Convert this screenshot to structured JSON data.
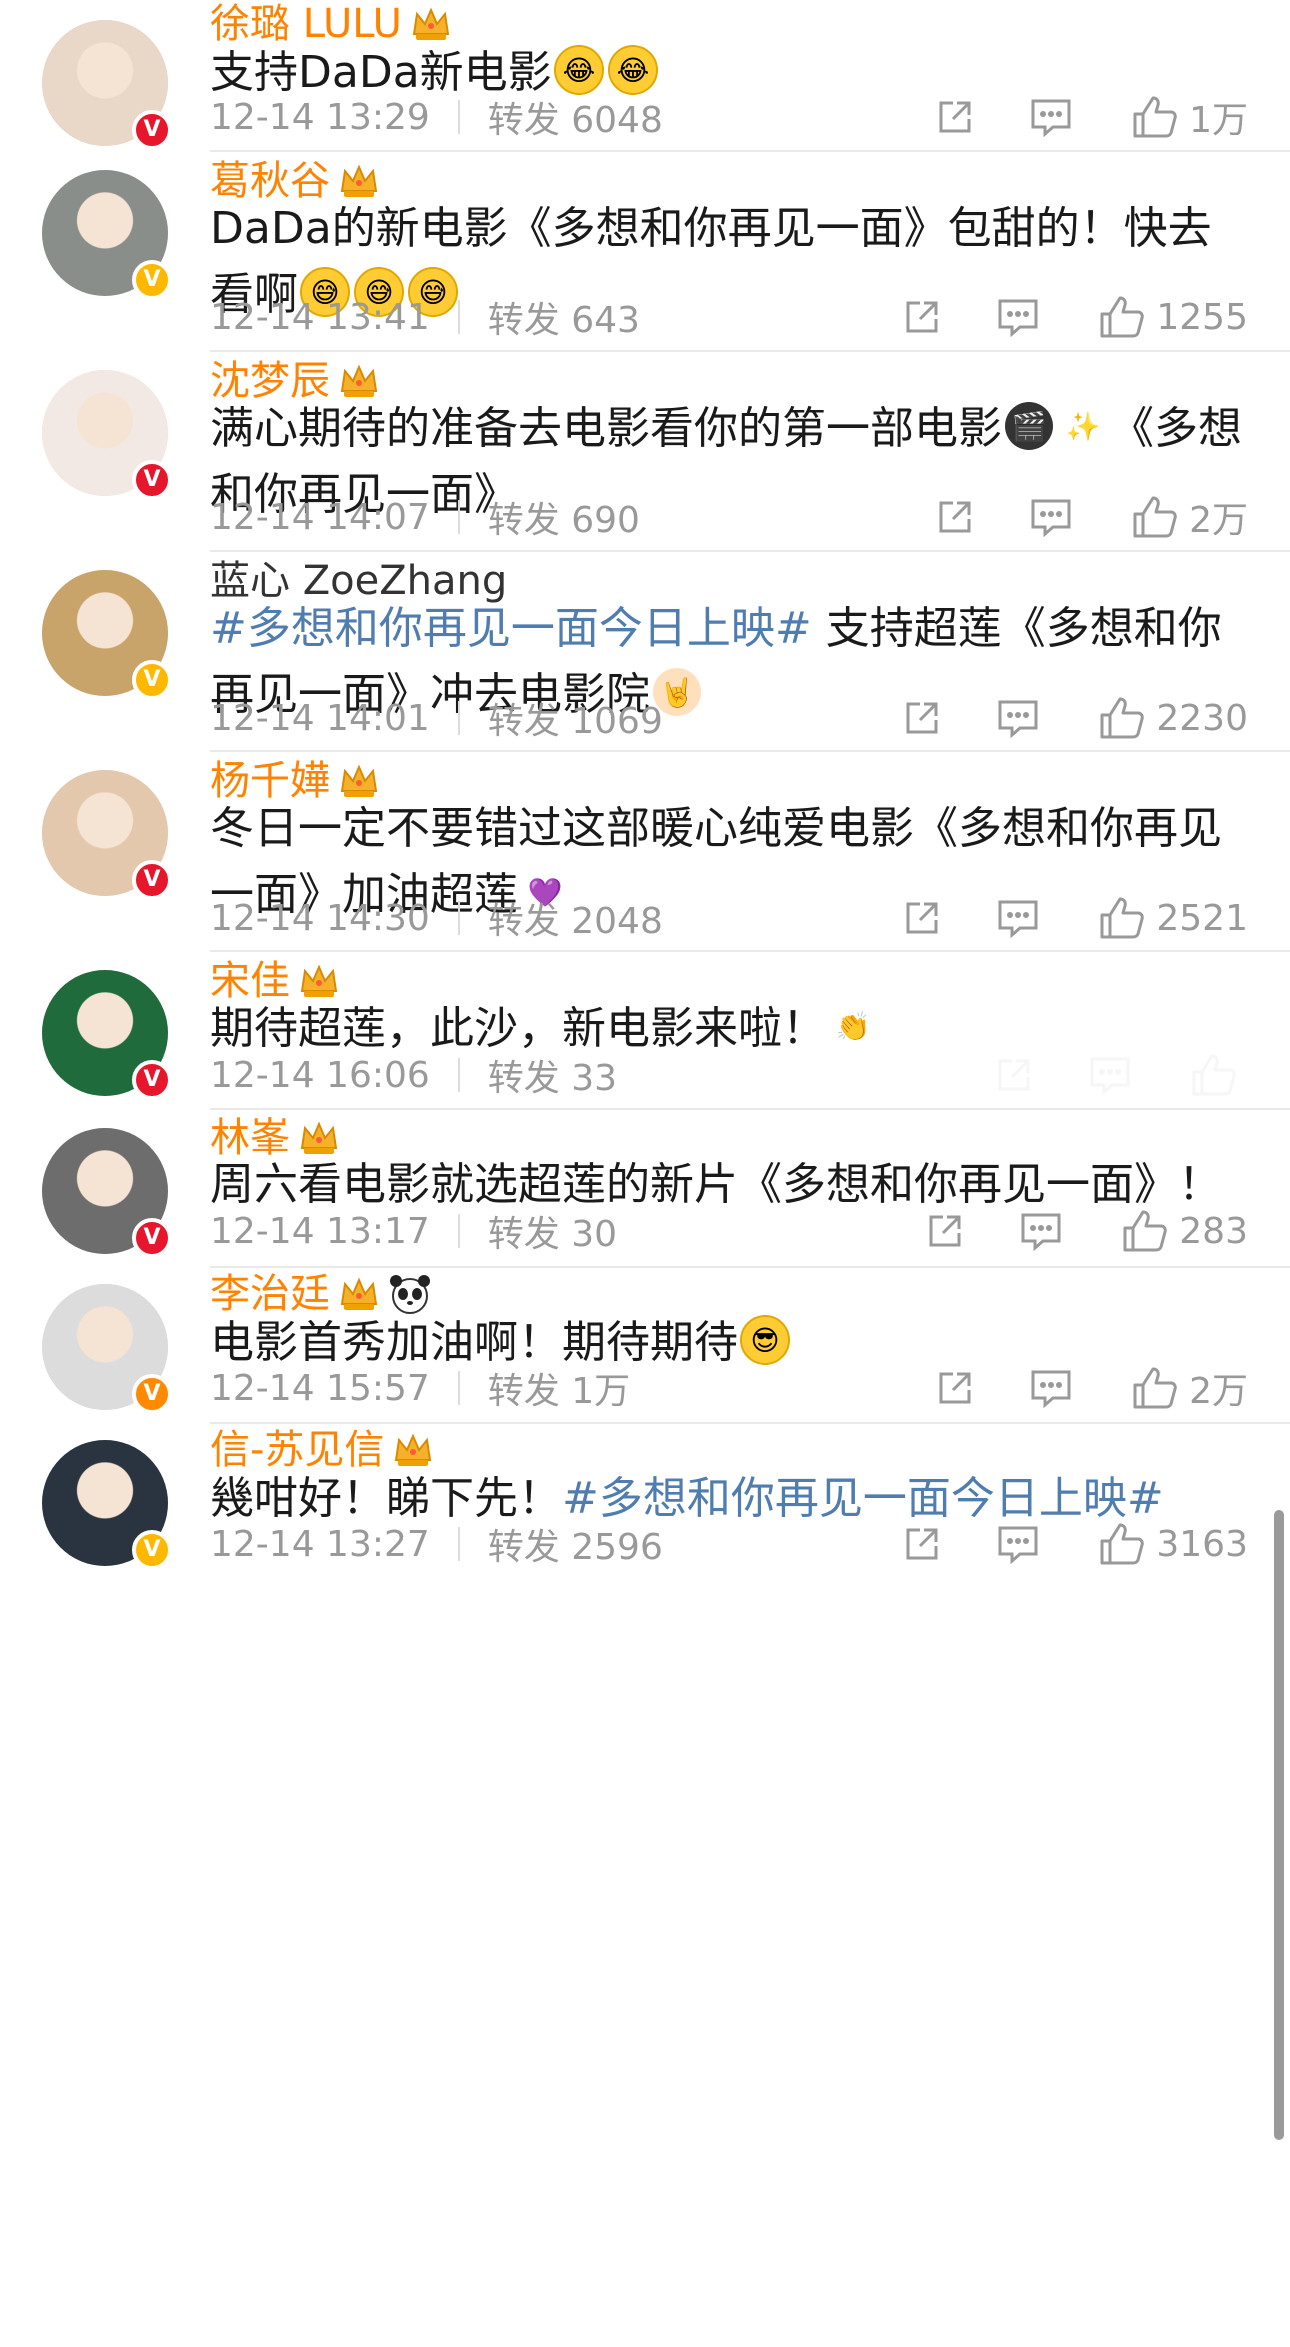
{
  "posts": [
    {
      "name": "徐璐 LULU",
      "crown": true,
      "extra_badge": null,
      "name_color": "orange",
      "badge": "red",
      "content_segments": [
        {
          "text": "支持DaDa新电影",
          "tag": false
        }
      ],
      "content_emojis": [
        "laugh-cry-emoji",
        "laugh-cry-emoji"
      ],
      "time": "12-14 13:29",
      "repost": "转发 6048",
      "likes": "1万"
    },
    {
      "name": "葛秋谷",
      "crown": true,
      "extra_badge": null,
      "name_color": "orange",
      "badge": "gold",
      "content_segments": [
        {
          "text": "DaDa的新电影《多想和你再见一面》包甜的！快去看啊",
          "tag": false
        }
      ],
      "content_emojis": [
        "sweat-laugh-emoji",
        "sweat-laugh-emoji",
        "sweat-laugh-emoji"
      ],
      "time": "12-14 13:41",
      "repost": "转发 643",
      "likes": "1255"
    },
    {
      "name": "沈梦辰",
      "crown": true,
      "extra_badge": null,
      "name_color": "orange",
      "badge": "red",
      "content_segments": [
        {
          "text": "满心期待的准备去电影看你的第一部电影",
          "tag": false
        },
        {
          "emoji": "clapperboard-emoji"
        },
        {
          "emoji": "sparkles-emoji"
        },
        {
          "text": "《多想和你再见一面》",
          "tag": false
        }
      ],
      "content_emojis": [],
      "time": "12-14 14:07",
      "repost": "转发 690",
      "likes": "2万"
    },
    {
      "name": "蓝心 ZoeZhang",
      "crown": false,
      "extra_badge": null,
      "name_color": "gray",
      "badge": "gold",
      "content_segments": [
        {
          "text": "#多想和你再见一面今日上映#",
          "tag": true
        },
        {
          "text": " 支持超莲《多想和你再见一面》冲去电影院",
          "tag": false
        }
      ],
      "content_emojis": [
        "rock-hand-emoji"
      ],
      "time": "12-14 14:01",
      "repost": "转发 1069",
      "likes": "2230"
    },
    {
      "name": "杨千嬅",
      "crown": true,
      "extra_badge": null,
      "name_color": "orange",
      "badge": "red",
      "content_segments": [
        {
          "text": "冬日一定不要错过这部暖心纯爱电影《多想和你再见一面》加油超莲",
          "tag": false
        }
      ],
      "content_emojis": [
        "purple-heart-emoji"
      ],
      "time": "12-14 14:30",
      "repost": "转发 2048",
      "likes": "2521"
    },
    {
      "name": "宋佳",
      "crown": true,
      "extra_badge": null,
      "name_color": "orange",
      "badge": "red",
      "content_segments": [
        {
          "text": "期待超莲，此沙，新电影来啦！",
          "tag": false
        }
      ],
      "content_emojis": [
        "clapping-hands-emoji"
      ],
      "time": "12-14 16:06",
      "repost": "转发 33",
      "likes": "",
      "faded_actions": true
    },
    {
      "name": "林峯",
      "crown": true,
      "extra_badge": null,
      "name_color": "orange",
      "badge": "red",
      "content_segments": [
        {
          "text": "周六看电影就选超莲的新片《多想和你再见一面》！",
          "tag": false
        }
      ],
      "content_emojis": [],
      "time": "12-14 13:17",
      "repost": "转发 30",
      "likes": "283"
    },
    {
      "name": "李治廷",
      "crown": true,
      "extra_badge": "panda",
      "name_color": "orange",
      "badge": "orange",
      "content_segments": [
        {
          "text": "电影首秀加油啊！期待期待",
          "tag": false
        }
      ],
      "content_emojis": [
        "sunglasses-emoji"
      ],
      "time": "12-14 15:57",
      "repost": "转发 1万",
      "likes": "2万"
    },
    {
      "name": "信-苏见信",
      "crown": true,
      "extra_badge": null,
      "name_color": "orange",
      "badge": "gold",
      "content_segments": [
        {
          "text": "幾咁好！睇下先！",
          "tag": false
        },
        {
          "text": "#多想和你再见一面今日上映#",
          "tag": true
        }
      ],
      "content_emojis": [],
      "time": "12-14 13:27",
      "repost": "转发 2596",
      "likes": "3163"
    }
  ],
  "colors": {
    "name_orange": "#ff8200",
    "topic_blue": "#507daf",
    "meta_gray": "#999999",
    "badge_red": "#e6162d",
    "badge_gold": "#ffb800"
  }
}
